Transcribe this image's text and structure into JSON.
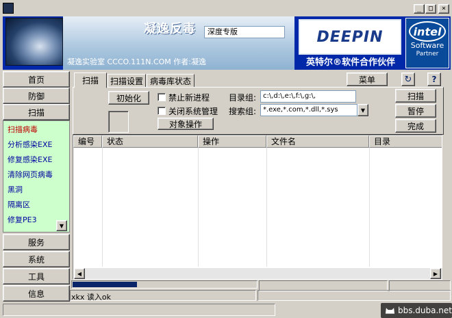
{
  "window": {
    "controls": {
      "minimize": "_",
      "maximize": "□",
      "close": "×"
    }
  },
  "banner": {
    "title": "凝逸反毒",
    "edition": "深度专版",
    "lab_line": "凝逸实验室 CCCO.111N.COM 作者:凝逸",
    "deepin_logo": "DEEPIN",
    "partner_text": "英特尔®软件合作伙伴",
    "intel": {
      "logo": "intel",
      "line1": "Software",
      "line2": "Partner"
    }
  },
  "sidebar": {
    "top_buttons": [
      "首页",
      "防御",
      "扫描"
    ],
    "items": [
      "扫描病毒",
      "分析感染EXE",
      "修复感染EXE",
      "清除网页病毒",
      "黑洞",
      "隔离区",
      "修复PE3"
    ],
    "active_item": "扫描病毒",
    "bottom_buttons": [
      "服务",
      "系统",
      "工具",
      "信息"
    ],
    "scroll_down_glyph": "▼"
  },
  "tabs": [
    "扫描",
    "扫描设置",
    "病毒库状态"
  ],
  "active_tab": "扫描",
  "toolbar": {
    "menu_label": "菜单",
    "refresh_glyph": "↻",
    "help_glyph": "?"
  },
  "scan_panel": {
    "init_button": "初始化",
    "opt_block_new_process": "禁止新进程",
    "opt_close_system_mgmt": "关闭系统管理",
    "object_ops_button": "对象操作",
    "dir_group_label": "目录组:",
    "dir_group_value": "c:\\,d:\\,e:\\,f:\\,g:\\,",
    "search_group_label": "搜索组:",
    "search_group_value": "*.exe,*.com,*.dll,*.sys",
    "combo_glyph": "▼",
    "scan_button": "扫描",
    "pause_button": "暂停",
    "done_button": "完成"
  },
  "table": {
    "columns": [
      "编号",
      "状态",
      "操作",
      "文件名",
      "目录"
    ]
  },
  "scroll": {
    "left_glyph": "◀",
    "right_glyph": "▶"
  },
  "status": {
    "progress": 0.35,
    "text": "xkx 读入ok"
  },
  "watermark": "bbs.duba.net"
}
